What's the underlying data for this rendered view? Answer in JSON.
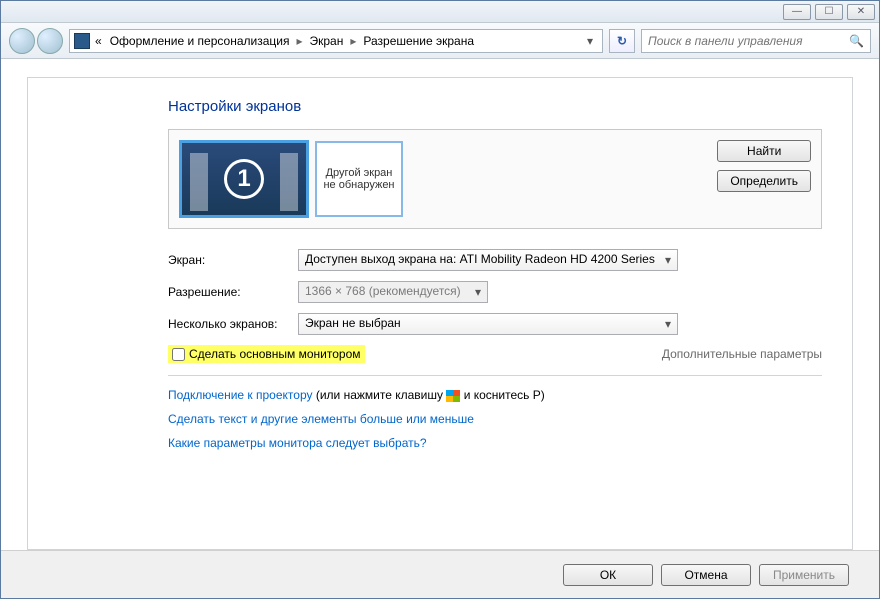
{
  "titlebar": {
    "min": "—",
    "max": "☐",
    "close": "✕"
  },
  "nav": {
    "breadcrumb_prefix": "«",
    "breadcrumb": [
      "Оформление и персонализация",
      "Экран",
      "Разрешение экрана"
    ],
    "search_placeholder": "Поиск в панели управления"
  },
  "page": {
    "title": "Настройки экранов",
    "preview": {
      "primary_num": "1",
      "not_detected": "Другой экран не обнаружен"
    },
    "buttons": {
      "find": "Найти",
      "identify": "Определить"
    },
    "form": {
      "screen_label": "Экран:",
      "screen_value": "Доступен выход экрана на: ATI Mobility Radeon HD 4200 Series",
      "resolution_label": "Разрешение:",
      "resolution_value": "1366 × 768 (рекомендуется)",
      "multi_label": "Несколько экранов:",
      "multi_value": "Экран не выбран"
    },
    "primary_checkbox": "Сделать основным монитором",
    "advanced": "Дополнительные параметры",
    "projector_link": "Подключение к проектору",
    "projector_hint_pre": " (или нажмите клавишу ",
    "projector_hint_post": " и коснитесь P)",
    "link_textsize": "Сделать текст и другие элементы больше или меньше",
    "link_which": "Какие параметры монитора следует выбрать?"
  },
  "footer": {
    "ok": "ОК",
    "cancel": "Отмена",
    "apply": "Применить"
  }
}
